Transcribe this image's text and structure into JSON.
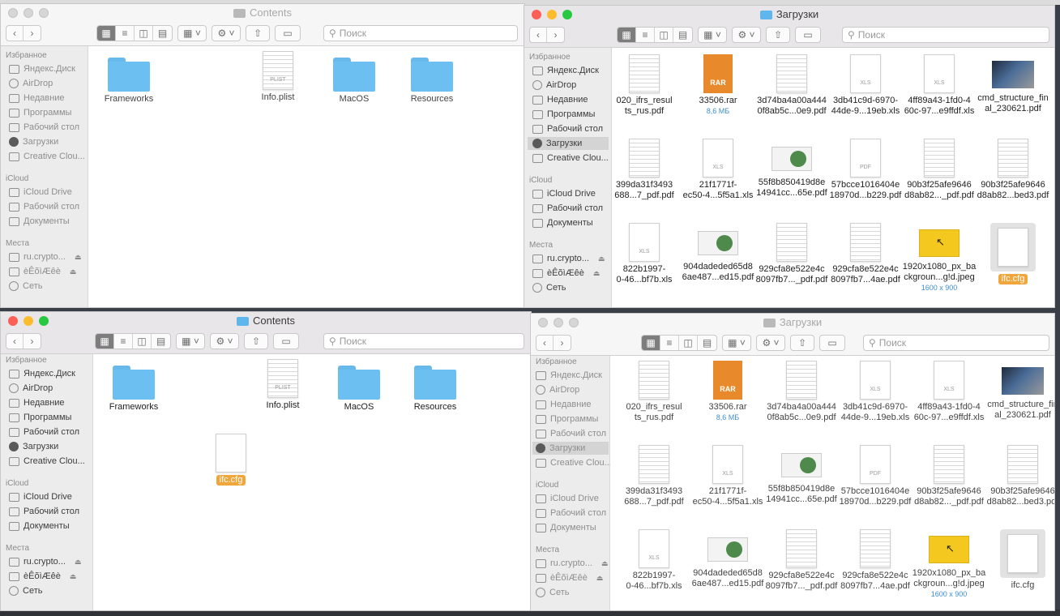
{
  "colors": {
    "close": "#fc5f57",
    "minimize": "#fdbc2e",
    "zoom": "#28c840",
    "folder": "#6cc0f1",
    "selection_label": "#f0a63a"
  },
  "toolbar": {
    "back_icon": "chevron-left",
    "forward_icon": "chevron-right",
    "view_icons": [
      "icons",
      "list",
      "columns",
      "gallery"
    ],
    "arrange_icon": "grid",
    "action_icon": "gear",
    "share_icon": "share",
    "tag_icon": "tag",
    "search_placeholder": "Поиск"
  },
  "sidebar": {
    "favorites_heading": "Избранное",
    "favorites": [
      "Яндекс.Диск",
      "AirDrop",
      "Недавние",
      "Программы",
      "Рабочий стол",
      "Загрузки",
      "Creative Clou..."
    ],
    "icloud_heading": "iCloud",
    "icloud": [
      "iCloud Drive",
      "Рабочий стол",
      "Документы"
    ],
    "places_heading": "Места",
    "places": [
      "ru.crypto...",
      "èÊõìÆêè",
      "Сеть"
    ]
  },
  "contents_window": {
    "title": "Contents",
    "items": [
      "Frameworks",
      "Info.plist",
      "MacOS",
      "Resources"
    ],
    "plist_tag": "PLIST",
    "dropped_item": "ifc.cfg"
  },
  "downloads_window": {
    "title": "Загрузки",
    "items": [
      {
        "line1": "020_ifrs_resul",
        "line2": "ts_rus.pdf",
        "kind": "doc"
      },
      {
        "line1": "33506.rar",
        "line2": "8,6 МБ",
        "kind": "rar",
        "tag": "RAR"
      },
      {
        "line1": "3d74ba4a00a444",
        "line2": "0f8ab5c...0e9.pdf",
        "kind": "doc"
      },
      {
        "line1": "3db41c9d-6970-",
        "line2": "44de-9...19eb.xls",
        "kind": "xls",
        "tag": "XLS"
      },
      {
        "line1": "4ff89a43-1fd0-4",
        "line2": "60c-97...e9ffdf.xls",
        "kind": "xls",
        "tag": "XLS"
      },
      {
        "line1": "cmd_structure_fin",
        "line2": "al_230621.pdf",
        "kind": "photo"
      },
      {
        "line1": "399da31f3493",
        "line2": "688...7_pdf.pdf",
        "kind": "doc"
      },
      {
        "line1": "21f1771f-",
        "line2": "ec50-4...5f5a1.xls",
        "kind": "xls",
        "tag": "XLS"
      },
      {
        "line1": "55f8b850419d8e",
        "line2": "14941cc...65e.pdf",
        "kind": "flyer"
      },
      {
        "line1": "57bcce1016404e",
        "line2": "18970d...b229.pdf",
        "kind": "pdf",
        "tag": "PDF"
      },
      {
        "line1": "90b3f25afe9646",
        "line2": "d8ab82..._pdf.pdf",
        "kind": "doc"
      },
      {
        "line1": "90b3f25afe9646",
        "line2": "d8ab82...bed3.pdf",
        "kind": "doc"
      },
      {
        "line1": "822b1997-",
        "line2": "0-46...bf7b.xls",
        "kind": "xls",
        "tag": "XLS"
      },
      {
        "line1": "904dadeded65d8",
        "line2": "6ae487...ed15.pdf",
        "kind": "flyer"
      },
      {
        "line1": "929cfa8e522e4c",
        "line2": "8097fb7..._pdf.pdf",
        "kind": "doc"
      },
      {
        "line1": "929cfa8e522e4c",
        "line2": "8097fb7...4ae.pdf",
        "kind": "doc"
      },
      {
        "line1": "1920x1080_px_ba",
        "line2": "ckgroun...g!d.jpeg",
        "line3": "1600 x 900",
        "kind": "yellow"
      },
      {
        "line1": "ifc.cfg",
        "line2": "",
        "kind": "cfg"
      }
    ]
  }
}
